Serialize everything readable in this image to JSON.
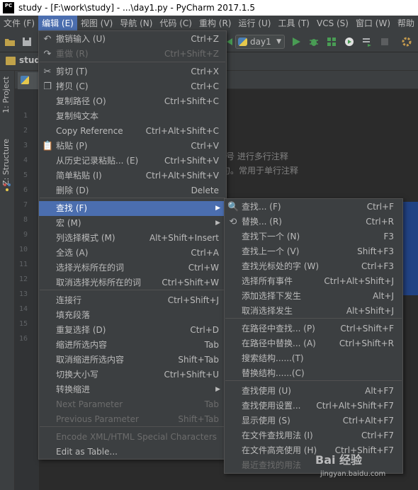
{
  "window": {
    "title": "study - [F:\\work\\study] - ...\\day1.py - PyCharm 2017.1.5",
    "app_icon": "PC"
  },
  "menubar": [
    {
      "label": "文件 (F)"
    },
    {
      "label": "编辑 (E)"
    },
    {
      "label": "视图 (V)"
    },
    {
      "label": "导航 (N)"
    },
    {
      "label": "代码 (C)"
    },
    {
      "label": "重构 (R)"
    },
    {
      "label": "运行 (U)"
    },
    {
      "label": "工具 (T)"
    },
    {
      "label": "VCS (S)"
    },
    {
      "label": "窗口 (W)"
    },
    {
      "label": "帮助"
    }
  ],
  "toolbar": {
    "run_config": "day1"
  },
  "navbar": {
    "crumb": "stud"
  },
  "left_tools": {
    "project": "1: Project",
    "structure": "Z: Structure"
  },
  "gutter": {
    "line_numbers": [
      "1",
      "2",
      "3",
      "4",
      "5",
      "6",
      "7",
      "8",
      "9",
      "10",
      "11",
      "12",
      "13",
      "14",
      "15",
      "16"
    ]
  },
  "editor": {
    "visible_text_1": "号 进行多行注释",
    "visible_text_2": "句。常用于单行注释"
  },
  "edit_menu": {
    "items": [
      {
        "label": "撤销输入 (U)",
        "shortcut": "Ctrl+Z"
      },
      {
        "label": "重做 (R)",
        "shortcut": "Ctrl+Shift+Z"
      },
      {
        "label": "剪切 (T)",
        "shortcut": "Ctrl+X"
      },
      {
        "label": "拷贝 (C)",
        "shortcut": "Ctrl+C"
      },
      {
        "label": "复制路径 (O)",
        "shortcut": "Ctrl+Shift+C"
      },
      {
        "label": "复制纯文本",
        "shortcut": ""
      },
      {
        "label": "Copy Reference",
        "shortcut": "Ctrl+Alt+Shift+C"
      },
      {
        "label": "粘贴 (P)",
        "shortcut": "Ctrl+V"
      },
      {
        "label": "从历史记录粘贴... (E)",
        "shortcut": "Ctrl+Shift+V"
      },
      {
        "label": "简单粘贴 (I)",
        "shortcut": "Ctrl+Alt+Shift+V"
      },
      {
        "label": "删除 (D)",
        "shortcut": "Delete"
      },
      {
        "label": "查找 (F)",
        "shortcut": ""
      },
      {
        "label": "宏 (M)",
        "shortcut": ""
      },
      {
        "label": "列选择模式 (M)",
        "shortcut": "Alt+Shift+Insert"
      },
      {
        "label": "全选 (A)",
        "shortcut": "Ctrl+A"
      },
      {
        "label": "选择光标所在的词",
        "shortcut": "Ctrl+W"
      },
      {
        "label": "取消选择光标所在的词",
        "shortcut": "Ctrl+Shift+W"
      },
      {
        "label": "连接行",
        "shortcut": "Ctrl+Shift+J"
      },
      {
        "label": "填充段落",
        "shortcut": ""
      },
      {
        "label": "重复选择 (D)",
        "shortcut": "Ctrl+D"
      },
      {
        "label": "缩进所选内容",
        "shortcut": "Tab"
      },
      {
        "label": "取消缩进所选内容",
        "shortcut": "Shift+Tab"
      },
      {
        "label": "切换大小写",
        "shortcut": "Ctrl+Shift+U"
      },
      {
        "label": "转换缩进",
        "shortcut": ""
      },
      {
        "label": "Next Parameter",
        "shortcut": "Tab"
      },
      {
        "label": "Previous Parameter",
        "shortcut": "Shift+Tab"
      },
      {
        "label": "Encode XML/HTML Special Characters",
        "shortcut": ""
      },
      {
        "label": "Edit as Table...",
        "shortcut": ""
      }
    ]
  },
  "find_menu": {
    "items": [
      {
        "label": "查找... (F)",
        "shortcut": "Ctrl+F"
      },
      {
        "label": "替换... (R)",
        "shortcut": "Ctrl+R"
      },
      {
        "label": "查找下一个 (N)",
        "shortcut": "F3"
      },
      {
        "label": "查找上一个 (V)",
        "shortcut": "Shift+F3"
      },
      {
        "label": "查找光标处的字 (W)",
        "shortcut": "Ctrl+F3"
      },
      {
        "label": "选择所有事件",
        "shortcut": "Ctrl+Alt+Shift+J"
      },
      {
        "label": "添加选择下发生",
        "shortcut": "Alt+J"
      },
      {
        "label": "取消选择发生",
        "shortcut": "Alt+Shift+J"
      },
      {
        "label": "在路径中查找... (P)",
        "shortcut": "Ctrl+Shift+F"
      },
      {
        "label": "在路径中替换... (A)",
        "shortcut": "Ctrl+Shift+R"
      },
      {
        "label": "搜索结构......(T)",
        "shortcut": ""
      },
      {
        "label": "替换结构......(C)",
        "shortcut": ""
      },
      {
        "label": "查找使用 (U)",
        "shortcut": "Alt+F7"
      },
      {
        "label": "查找使用设置...",
        "shortcut": "Ctrl+Alt+Shift+F7"
      },
      {
        "label": "显示使用 (S)",
        "shortcut": "Ctrl+Alt+F7"
      },
      {
        "label": "在文件查找用法 (I)",
        "shortcut": "Ctrl+F7"
      },
      {
        "label": "在文件高亮使用 (H)",
        "shortcut": "Ctrl+Shift+F7"
      },
      {
        "label": "最近查找的用法",
        "shortcut": ""
      }
    ]
  },
  "watermark": {
    "brand": "Bai 经验",
    "url": "jingyan.baidu.com"
  },
  "colors": {
    "menu_bg": "#3c3f41",
    "selection": "#4b6eaf",
    "editor_bg": "#2b2b2b",
    "run_green": "#499c54"
  }
}
